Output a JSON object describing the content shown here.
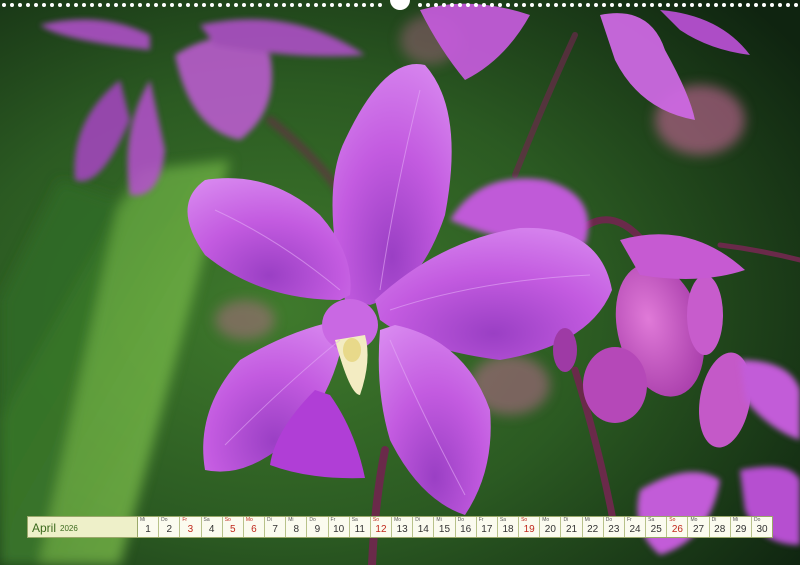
{
  "calendar": {
    "month": "April",
    "year": "2026",
    "days": [
      {
        "wd": "Mi",
        "d": "1",
        "red": false
      },
      {
        "wd": "Do",
        "d": "2",
        "red": false
      },
      {
        "wd": "Fr",
        "d": "3",
        "red": true
      },
      {
        "wd": "Sa",
        "d": "4",
        "red": false
      },
      {
        "wd": "So",
        "d": "5",
        "red": true
      },
      {
        "wd": "Mo",
        "d": "6",
        "red": true
      },
      {
        "wd": "Di",
        "d": "7",
        "red": false
      },
      {
        "wd": "Mi",
        "d": "8",
        "red": false
      },
      {
        "wd": "Do",
        "d": "9",
        "red": false
      },
      {
        "wd": "Fr",
        "d": "10",
        "red": false
      },
      {
        "wd": "Sa",
        "d": "11",
        "red": false
      },
      {
        "wd": "So",
        "d": "12",
        "red": true
      },
      {
        "wd": "Mo",
        "d": "13",
        "red": false
      },
      {
        "wd": "Di",
        "d": "14",
        "red": false
      },
      {
        "wd": "Mi",
        "d": "15",
        "red": false
      },
      {
        "wd": "Do",
        "d": "16",
        "red": false
      },
      {
        "wd": "Fr",
        "d": "17",
        "red": false
      },
      {
        "wd": "Sa",
        "d": "18",
        "red": false
      },
      {
        "wd": "So",
        "d": "19",
        "red": true
      },
      {
        "wd": "Mo",
        "d": "20",
        "red": false
      },
      {
        "wd": "Di",
        "d": "21",
        "red": false
      },
      {
        "wd": "Mi",
        "d": "22",
        "red": false
      },
      {
        "wd": "Do",
        "d": "23",
        "red": false
      },
      {
        "wd": "Fr",
        "d": "24",
        "red": false
      },
      {
        "wd": "Sa",
        "d": "25",
        "red": false
      },
      {
        "wd": "So",
        "d": "26",
        "red": true
      },
      {
        "wd": "Mo",
        "d": "27",
        "red": false
      },
      {
        "wd": "Di",
        "d": "28",
        "red": false
      },
      {
        "wd": "Mi",
        "d": "29",
        "red": false
      },
      {
        "wd": "Do",
        "d": "30",
        "red": false
      }
    ]
  },
  "colors": {
    "accent_green": "#3c6a1e",
    "holiday_red": "#c0281c",
    "petal": "#c35be0"
  }
}
